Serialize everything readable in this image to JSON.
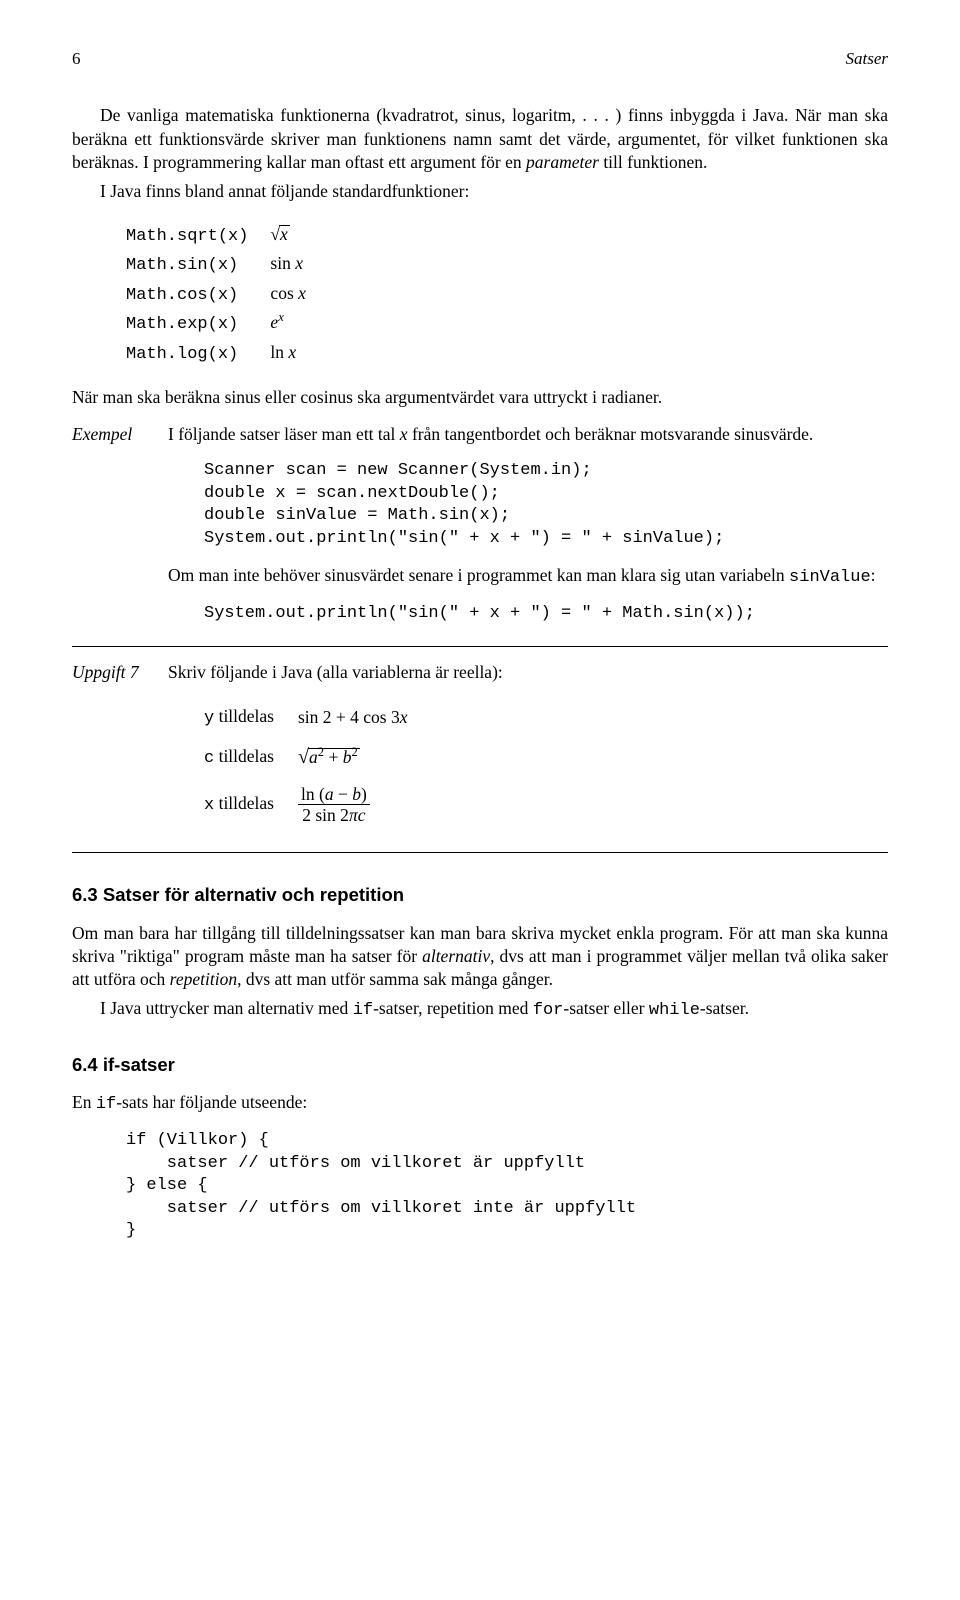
{
  "header": {
    "page_num": "6",
    "section": "Satser"
  },
  "intro": {
    "p1_a": "De vanliga matematiska funktionerna (kvadratrot, sinus, logaritm, . . . ) finns inbyggda i Java. När man ska beräkna ett funktionsvärde skriver man funktionens namn samt det värde, argumentet, för vilket funktionen ska beräknas. I programmering kallar man oftast ett argument för en ",
    "p1_param": "parameter",
    "p1_b": " till funktionen.",
    "p2": "I Java finns bland annat följande standardfunktioner:"
  },
  "func_rows": [
    {
      "code": "Math.sqrt(x)",
      "math": "sqrt_x"
    },
    {
      "code": "Math.sin(x)",
      "math": "sin_x"
    },
    {
      "code": "Math.cos(x)",
      "math": "cos_x"
    },
    {
      "code": "Math.exp(x)",
      "math": "e_x"
    },
    {
      "code": "Math.log(x)",
      "math": "ln_x"
    }
  ],
  "math_strings": {
    "sin": "sin",
    "cos": "cos",
    "ln": "ln",
    "x": "x",
    "e": "e"
  },
  "note_radian": "När man ska beräkna sinus eller cosinus ska argumentvärdet vara uttryckt i radianer.",
  "example": {
    "label": "Exempel",
    "desc_a": "I följande satser läser man ett tal ",
    "desc_var": "x",
    "desc_b": " från tangentbordet och beräknar motsvarande sinusvärde.",
    "code1": "Scanner scan = new Scanner(System.in);\ndouble x = scan.nextDouble();\ndouble sinValue = Math.sin(x);\nSystem.out.println(\"sin(\" + x + \") = \" + sinValue);",
    "mid_a": "Om man inte behöver sinusvärdet senare i programmet kan man klara sig utan variabeln ",
    "mid_var": "sinValue",
    "mid_b": ":",
    "code2": "System.out.println(\"sin(\" + x + \") = \" + Math.sin(x));"
  },
  "uppgift": {
    "label": "Uppgift 7",
    "desc": "Skriv följande i Java (alla variablerna är reella):",
    "rows": {
      "y_lhs": "y",
      "assign_word": "tilldelas",
      "c_lhs": "c",
      "x_lhs": "x"
    },
    "expr": {
      "y": {
        "text_a": "sin 2 + 4 cos 3",
        "var": "x"
      },
      "c": {
        "a": "a",
        "b": "b",
        "sq": "2",
        "plus": " + "
      },
      "x": {
        "ln": "ln",
        "open": " (",
        "a": "a",
        "minus": " − ",
        "b": "b",
        "close": ")",
        "two": "2",
        "sin": " sin 2",
        "pi": "π",
        "c": "c"
      }
    }
  },
  "sec63": {
    "heading": "6.3   Satser för alternativ och repetition",
    "p1_a": "Om man bara har tillgång till tilldelningssatser kan man bara skriva mycket enkla program. För att man ska kunna skriva \"riktiga\" program måste man ha satser för ",
    "p1_alt": "alternativ",
    "p1_b": ", dvs att man i programmet väljer mellan två olika saker att utföra och ",
    "p1_rep": "repetition",
    "p1_c": ", dvs att man utför samma sak många gånger.",
    "p2_a": "I Java uttrycker man alternativ med ",
    "p2_if": "if",
    "p2_b": "-satser, repetition med ",
    "p2_for": "for",
    "p2_c": "-satser eller ",
    "p2_while": "while",
    "p2_d": "-satser."
  },
  "sec64": {
    "heading": "6.4   if-satser",
    "p1_a": "En ",
    "p1_if": "if",
    "p1_b": "-sats har följande utseende:",
    "code": "if (Villkor) {\n    satser // utförs om villkoret är uppfyllt\n} else {\n    satser // utförs om villkoret inte är uppfyllt\n}"
  }
}
